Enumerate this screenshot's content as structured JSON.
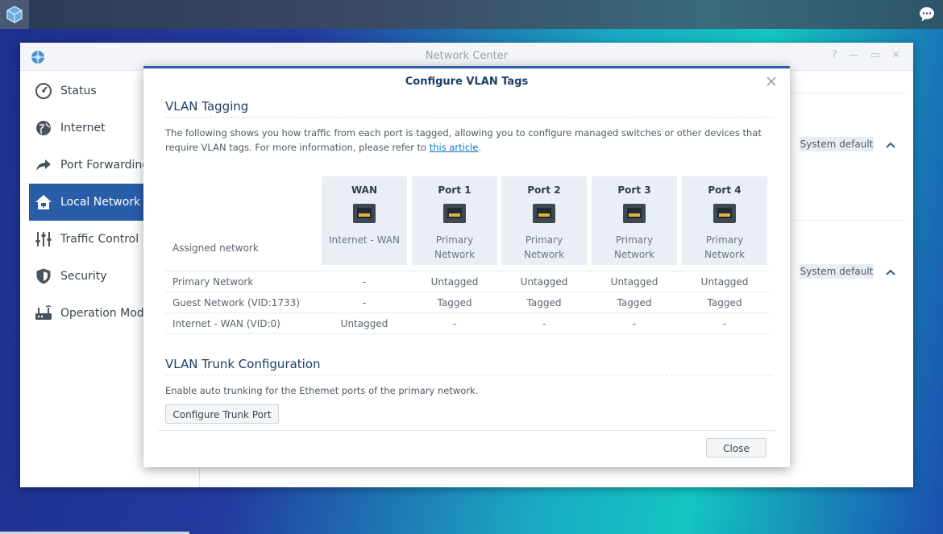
{
  "window": {
    "title": "Network Center",
    "controls": [
      "?",
      "—",
      "▭",
      "✕"
    ]
  },
  "sidebar": {
    "items": [
      {
        "label": "Status",
        "icon": "gauge-icon"
      },
      {
        "label": "Internet",
        "icon": "globe-icon"
      },
      {
        "label": "Port Forwarding",
        "icon": "share-arrow-icon"
      },
      {
        "label": "Local Network",
        "icon": "home-network-icon",
        "active": true
      },
      {
        "label": "Traffic Control",
        "icon": "sliders-icon"
      },
      {
        "label": "Security",
        "icon": "shield-icon"
      },
      {
        "label": "Operation Modes",
        "icon": "router-icon"
      }
    ]
  },
  "background": {
    "system_default_1": "System default",
    "system_default_2": "System default"
  },
  "modal": {
    "title": "Configure VLAN Tags",
    "vlan_tagging_title": "VLAN Tagging",
    "description": "The following shows you how traffic from each port is tagged, allowing you to configure managed switches or other devices that require VLAN tags. For more information, please refer to ",
    "link_text": "this article",
    "description_end": ".",
    "assigned_network_label": "Assigned network",
    "ports": [
      {
        "name": "WAN",
        "network": "Internet - WAN"
      },
      {
        "name": "Port 1",
        "network": "Primary Network"
      },
      {
        "name": "Port 2",
        "network": "Primary Network"
      },
      {
        "name": "Port 3",
        "network": "Primary Network"
      },
      {
        "name": "Port 4",
        "network": "Primary Network"
      }
    ],
    "rows": [
      {
        "label": "Primary Network",
        "values": [
          "-",
          "Untagged",
          "Untagged",
          "Untagged",
          "Untagged"
        ]
      },
      {
        "label": "Guest Network (VID:1733)",
        "values": [
          "-",
          "Tagged",
          "Tagged",
          "Tagged",
          "Tagged"
        ]
      },
      {
        "label": "Internet - WAN (VID:0)",
        "values": [
          "Untagged",
          "-",
          "-",
          "-",
          "-"
        ]
      }
    ],
    "trunk_title": "VLAN Trunk Configuration",
    "trunk_description": "Enable auto trunking for the Ethemet ports of the primary network.",
    "trunk_button": "Configure Trunk Port",
    "close_button": "Close"
  },
  "colors": {
    "accent": "#2a5da8",
    "title_text": "#1d3e66",
    "link": "#0a78c2"
  }
}
